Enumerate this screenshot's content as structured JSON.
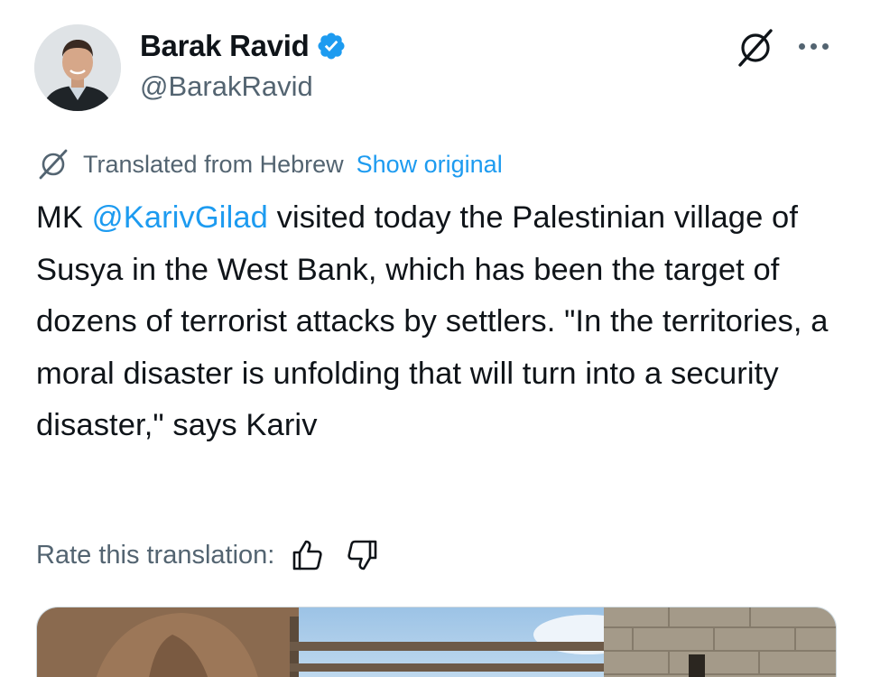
{
  "author": {
    "display_name": "Barak Ravid",
    "handle": "@BarakRavid",
    "verified": true,
    "avatar_icon": "profile-photo"
  },
  "header_icons": {
    "grok": "grok-icon",
    "more": "more-options-icon"
  },
  "translation": {
    "label": "Translated from Hebrew",
    "show_original": "Show original",
    "icon": "grok-translate-icon"
  },
  "tweet": {
    "prefix": "MK ",
    "mention": "@KarivGilad",
    "body": " visited today the Palestinian village of Susya in the West Bank, which has been the target of dozens of terrorist attacks by settlers. \"In the territories, a moral disaster is unfolding that will turn into a security disaster,\" says Kariv"
  },
  "rate": {
    "label": "Rate this translation:",
    "thumbs_up_icon": "thumbs-up-icon",
    "thumbs_down_icon": "thumbs-down-icon"
  },
  "colors": {
    "link": "#1d9bf0",
    "secondary_text": "#536471",
    "primary_text": "#0f1419",
    "verified": "#1d9bf0"
  }
}
